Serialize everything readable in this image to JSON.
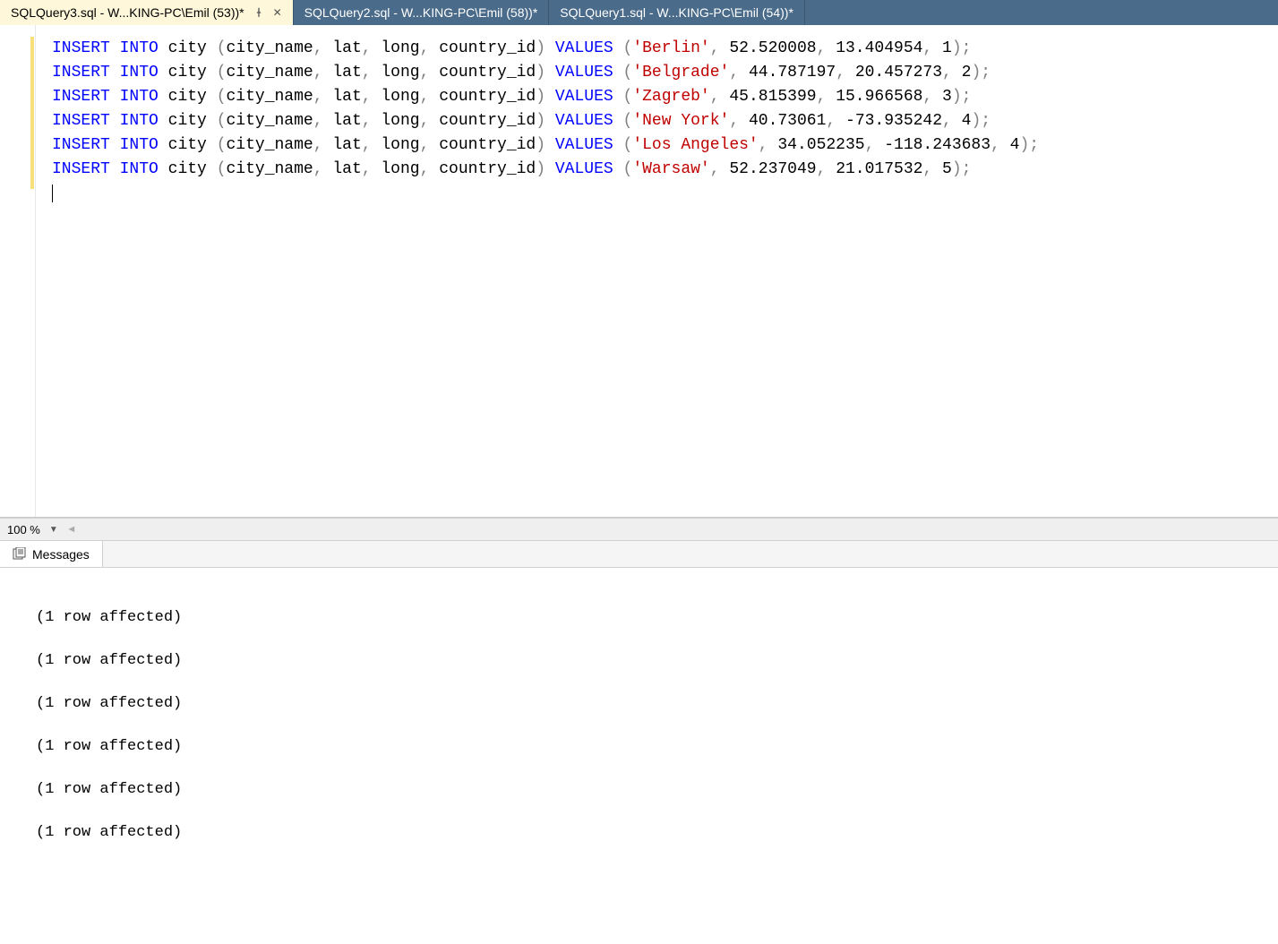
{
  "tabs": [
    {
      "label": "SQLQuery3.sql - W...KING-PC\\Emil (53))*",
      "active": true,
      "pinned": true
    },
    {
      "label": "SQLQuery2.sql - W...KING-PC\\Emil (58))*",
      "active": false
    },
    {
      "label": "SQLQuery1.sql - W...KING-PC\\Emil (54))*",
      "active": false
    }
  ],
  "sql": {
    "table": "city",
    "columns": [
      "city_name",
      "lat",
      "long",
      "country_id"
    ],
    "rows": [
      {
        "city_name": "Berlin",
        "lat": "52.520008",
        "long": "13.404954",
        "country_id": "1"
      },
      {
        "city_name": "Belgrade",
        "lat": "44.787197",
        "long": "20.457273",
        "country_id": "2"
      },
      {
        "city_name": "Zagreb",
        "lat": "45.815399",
        "long": "15.966568",
        "country_id": "3"
      },
      {
        "city_name": "New York",
        "lat": "40.73061",
        "long": "-73.935242",
        "country_id": "4"
      },
      {
        "city_name": "Los Angeles",
        "lat": "34.052235",
        "long": "-118.243683",
        "country_id": "4"
      },
      {
        "city_name": "Warsaw",
        "lat": "52.237049",
        "long": "21.017532",
        "country_id": "5"
      }
    ],
    "keywords": {
      "insert": "INSERT",
      "into": "INTO",
      "values": "VALUES"
    }
  },
  "zoom": {
    "value": "100 %"
  },
  "results": {
    "tab_label": "Messages",
    "messages": [
      "(1 row affected)",
      "(1 row affected)",
      "(1 row affected)",
      "(1 row affected)",
      "(1 row affected)",
      "(1 row affected)"
    ]
  }
}
